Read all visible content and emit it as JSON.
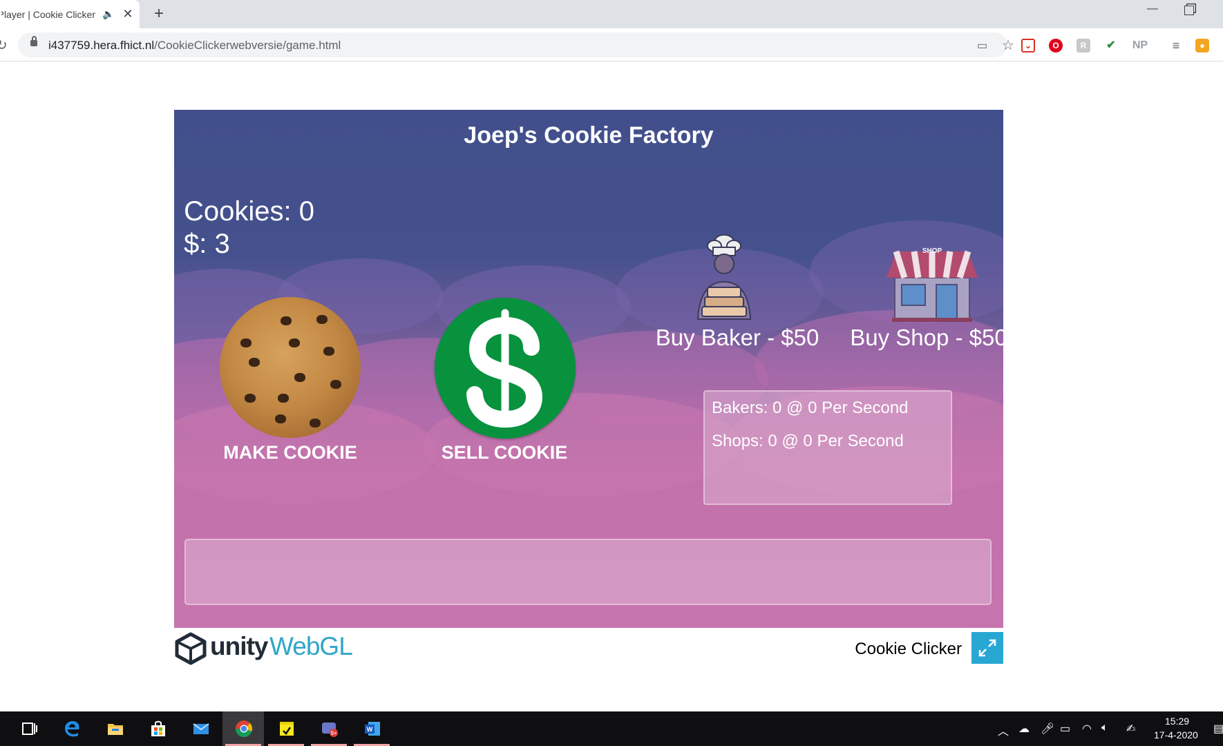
{
  "browser": {
    "tab_title": "WebGL Player | Cookie Clicker",
    "new_tab": "+",
    "url_host": "i437759.hera.fhict.nl",
    "url_path": "/CookieClickerwebversie/game.html",
    "extensions": [
      "pocket-icon",
      "opera-icon",
      "r-extension-icon",
      "colorful-extension-icon",
      "NP",
      "reading-list-icon",
      "user-extension-icon"
    ],
    "np_label": "NP"
  },
  "game": {
    "title": "Joep's Cookie Factory",
    "cookies_text": "Cookies: 0",
    "money_text": "$: 3",
    "make_cookie_label": "MAKE COOKIE",
    "sell_cookie_label": "SELL COOKIE",
    "buy_baker_label": "Buy Baker - $50",
    "buy_shop_label": "Buy Shop - $50",
    "shop_sign": "SHOP",
    "stats": {
      "bakers": "Bakers: 0 @ 0 Per Second",
      "shops": "Shops: 0 @ 0 Per Second"
    },
    "message": ""
  },
  "footer": {
    "unity_text": "unity",
    "webgl_text": "WebGL",
    "build_title": "Cookie Clicker"
  },
  "taskbar": {
    "apps": [
      "task-view-icon",
      "edge-icon",
      "file-explorer-icon",
      "store-icon",
      "mail-icon",
      "chrome-icon",
      "sticky-notes-icon",
      "teams-icon",
      "word-icon"
    ],
    "clock_time": "15:29",
    "clock_date": "17-4-2020"
  },
  "colors": {
    "sky_top": "#414f8c",
    "sky_bottom": "#c674ad",
    "money_green": "#08923e",
    "unity_blue": "#2fa6c7",
    "fullscreen": "#29a7d3"
  }
}
